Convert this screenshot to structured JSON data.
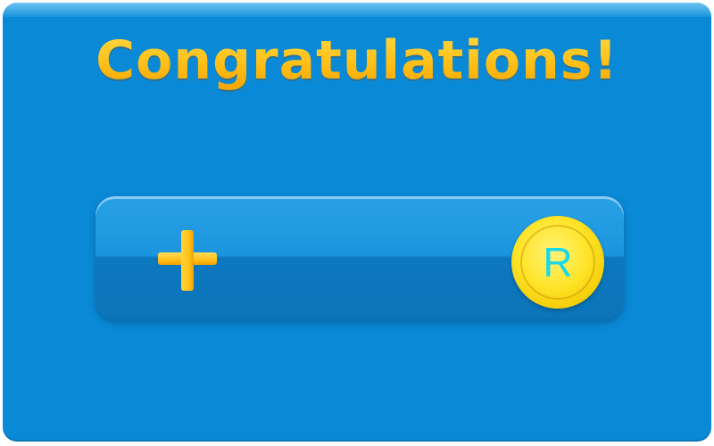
{
  "dialog": {
    "title": "Congratulations!"
  },
  "reward": {
    "add_icon": "plus-icon",
    "currency_icon": "coin-icon",
    "currency_letter": "R"
  },
  "colors": {
    "panel": "#0a89d7",
    "title_gold": "#ffc21a",
    "coin_yellow": "#ffe52a",
    "coin_letter": "#1ad8e8"
  }
}
